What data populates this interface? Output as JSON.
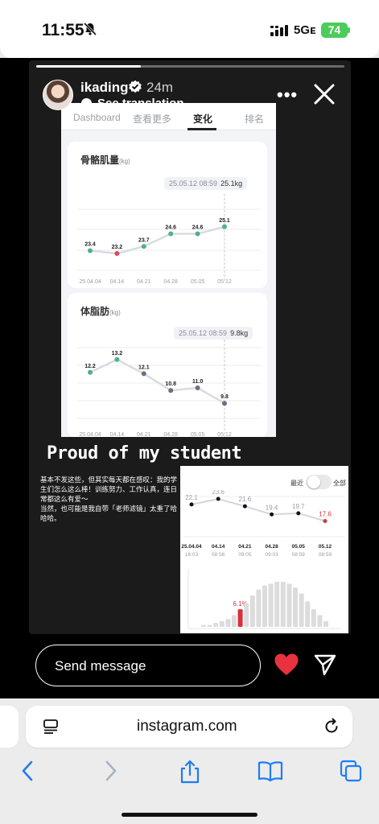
{
  "status": {
    "time": "11:55",
    "network": "5Gᴇ",
    "battery": "74"
  },
  "story": {
    "username": "ikading",
    "time_ago": "24m",
    "translate_label": "See translation",
    "progress": 0.34,
    "headline": "Proud of my student",
    "caption": "基本不发这些，但其实每天都在感叹：我的学生们怎么这么棒！训练努力、工作认真，连日常都这么有爱～\n当然，也可能是我自带「老师滤镜」太重了哈哈哈。"
  },
  "screenshot": {
    "tabs": [
      "Dashboard",
      "查看更多",
      "变化",
      "排名"
    ],
    "active_tab": "变化",
    "muscle": {
      "title": "骨骼肌量",
      "unit": "(kg)",
      "tooltip_date": "25.05.12 08:59",
      "tooltip_value": "25.1kg"
    },
    "fat": {
      "title": "体脂肪",
      "unit": "(kg)",
      "tooltip_date": "25.05.12 08:59",
      "tooltip_value": "9.8kg"
    }
  },
  "screenshot2": {
    "recent_label": "最近",
    "all_label": "全部",
    "highlight_percent": "6.1%"
  },
  "reply": {
    "placeholder": "Send message"
  },
  "safari": {
    "url": "instagram.com"
  },
  "colors": {
    "highlight_red": "#d9303c",
    "green_point": "#4cb08f",
    "toggle": "#e9e9ec"
  },
  "chart_data": [
    {
      "type": "line",
      "title": "骨骼肌量",
      "ylabel": "(kg)",
      "categories": [
        "25.04.04",
        "04.14",
        "04.21",
        "04.28",
        "05.05",
        "05.12"
      ],
      "values": [
        23.4,
        23.2,
        23.7,
        24.6,
        24.6,
        25.1
      ],
      "point_colors": [
        "#4cb08f",
        "#e0465a",
        "#4cb08f",
        "#4cb08f",
        "#4cb08f",
        "#4cb08f"
      ],
      "ylim": [
        22.0,
        26.0
      ]
    },
    {
      "type": "line",
      "title": "体脂肪",
      "ylabel": "(kg)",
      "categories": [
        "25.04.04",
        "04.14",
        "04.21",
        "04.28",
        "05.05",
        "05.12"
      ],
      "values": [
        12.2,
        13.2,
        12.1,
        10.8,
        11.0,
        9.8
      ],
      "point_colors": [
        "#4cb08f",
        "#4cb08f",
        "#6b6f80",
        "#6b6f80",
        "#6b6f80",
        "#6b6f80"
      ],
      "ylim": [
        8.0,
        14.5
      ]
    },
    {
      "type": "line",
      "categories": [
        "25.04.04",
        "04.14",
        "04.21",
        "04.28",
        "05.05",
        "05.12"
      ],
      "times": [
        "16:03",
        "08:56",
        "09:05",
        "09:03",
        "08:59",
        "08:59"
      ],
      "values": [
        22.1,
        23.6,
        21.6,
        19.4,
        19.7,
        17.6
      ],
      "ylim": [
        14.0,
        26.0
      ]
    },
    {
      "type": "bar",
      "values": [
        1,
        1,
        2,
        3,
        4,
        6,
        9,
        12,
        16,
        19,
        21,
        22,
        23,
        23,
        22,
        20,
        17,
        13,
        9,
        6,
        3
      ],
      "highlight_index": 6,
      "highlight_label": "6.1%"
    }
  ]
}
